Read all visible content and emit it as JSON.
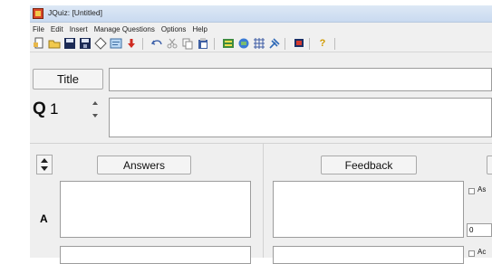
{
  "window": {
    "title": "JQuiz: [Untitled]"
  },
  "menu": [
    "File",
    "Edit",
    "Insert",
    "Manage Questions",
    "Options",
    "Help"
  ],
  "toolbar": {
    "icons": [
      "new-file-icon",
      "open-folder-icon",
      "save-icon",
      "save-as-icon",
      "diamond-icon",
      "web-page-icon",
      "down-arrow-icon",
      "undo-icon",
      "cut-icon",
      "copy-icon",
      "paste-icon",
      "config-icon",
      "export-icon",
      "grid-icon",
      "tool-icon",
      "flag-icon",
      "help-icon"
    ],
    "help_label": "?"
  },
  "title_row": {
    "button_label": "Title",
    "value": ""
  },
  "question": {
    "prefix": "Q",
    "number": "1",
    "text": ""
  },
  "answers_panel": {
    "header_label": "Answers",
    "sort_icon": "up-down-arrows-icon"
  },
  "feedback_panel": {
    "header_label": "Feedback"
  },
  "answer_rows": [
    {
      "letter": "A",
      "answer_text": "",
      "feedback_text": "",
      "option_label": "As",
      "option_value": "0"
    },
    {
      "letter": "",
      "answer_text": "",
      "feedback_text": "",
      "option_label": "Ac",
      "option_value": ""
    }
  ]
}
